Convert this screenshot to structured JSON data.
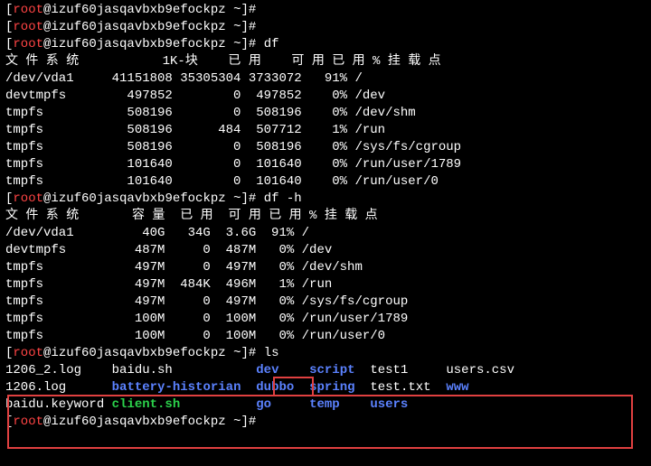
{
  "prompt": {
    "user": "root",
    "host": "izuf60jasqavbxb9efockpz",
    "path": "~",
    "symbol": "#"
  },
  "commands": {
    "df": "df",
    "dfh": "df -h",
    "ls": "ls"
  },
  "df": {
    "header": "文 件 系 统           1K-块    已 用    可 用 已 用 % 挂 载 点",
    "rows": [
      {
        "fs": "/dev/vda1",
        "sz": "41151808",
        "used": "35305304",
        "avail": "3733072",
        "pct": "91%",
        "mount": "/"
      },
      {
        "fs": "devtmpfs",
        "sz": "497852",
        "used": "0",
        "avail": "497852",
        "pct": "0%",
        "mount": "/dev"
      },
      {
        "fs": "tmpfs",
        "sz": "508196",
        "used": "0",
        "avail": "508196",
        "pct": "0%",
        "mount": "/dev/shm"
      },
      {
        "fs": "tmpfs",
        "sz": "508196",
        "used": "484",
        "avail": "507712",
        "pct": "1%",
        "mount": "/run"
      },
      {
        "fs": "tmpfs",
        "sz": "508196",
        "used": "0",
        "avail": "508196",
        "pct": "0%",
        "mount": "/sys/fs/cgroup"
      },
      {
        "fs": "tmpfs",
        "sz": "101640",
        "used": "0",
        "avail": "101640",
        "pct": "0%",
        "mount": "/run/user/1789"
      },
      {
        "fs": "tmpfs",
        "sz": "101640",
        "used": "0",
        "avail": "101640",
        "pct": "0%",
        "mount": "/run/user/0"
      }
    ]
  },
  "dfh": {
    "header": "文 件 系 统       容 量  已 用  可 用 已 用 % 挂 载 点",
    "rows": [
      {
        "fs": "/dev/vda1",
        "sz": "40G",
        "used": "34G",
        "avail": "3.6G",
        "pct": "91%",
        "mount": "/"
      },
      {
        "fs": "devtmpfs",
        "sz": "487M",
        "used": "0",
        "avail": "487M",
        "pct": "0%",
        "mount": "/dev"
      },
      {
        "fs": "tmpfs",
        "sz": "497M",
        "used": "0",
        "avail": "497M",
        "pct": "0%",
        "mount": "/dev/shm"
      },
      {
        "fs": "tmpfs",
        "sz": "497M",
        "used": "484K",
        "avail": "496M",
        "pct": "1%",
        "mount": "/run"
      },
      {
        "fs": "tmpfs",
        "sz": "497M",
        "used": "0",
        "avail": "497M",
        "pct": "0%",
        "mount": "/sys/fs/cgroup"
      },
      {
        "fs": "tmpfs",
        "sz": "100M",
        "used": "0",
        "avail": "100M",
        "pct": "0%",
        "mount": "/run/user/1789"
      },
      {
        "fs": "tmpfs",
        "sz": "100M",
        "used": "0",
        "avail": "100M",
        "pct": "0%",
        "mount": "/run/user/0"
      }
    ]
  },
  "ls": {
    "rows": [
      [
        {
          "name": "1206_2.log",
          "type": "plain"
        },
        {
          "name": "baidu.sh",
          "type": "plain"
        },
        {
          "name": "dev",
          "type": "dir"
        },
        {
          "name": "script",
          "type": "dir"
        },
        {
          "name": "test1",
          "type": "plain"
        },
        {
          "name": "users.csv",
          "type": "plain"
        }
      ],
      [
        {
          "name": "1206.log",
          "type": "plain"
        },
        {
          "name": "battery-historian",
          "type": "dir"
        },
        {
          "name": "dubbo",
          "type": "dir"
        },
        {
          "name": "spring",
          "type": "dir"
        },
        {
          "name": "test.txt",
          "type": "plain"
        },
        {
          "name": "www",
          "type": "dir"
        }
      ],
      [
        {
          "name": "baidu.keyword",
          "type": "plain"
        },
        {
          "name": "client.sh",
          "type": "exe"
        },
        {
          "name": "go",
          "type": "dir"
        },
        {
          "name": "temp",
          "type": "dir"
        },
        {
          "name": "users",
          "type": "dir"
        },
        {
          "name": "",
          "type": "plain"
        }
      ]
    ]
  },
  "ls_cols": [
    14,
    19,
    7,
    8,
    10,
    10
  ]
}
